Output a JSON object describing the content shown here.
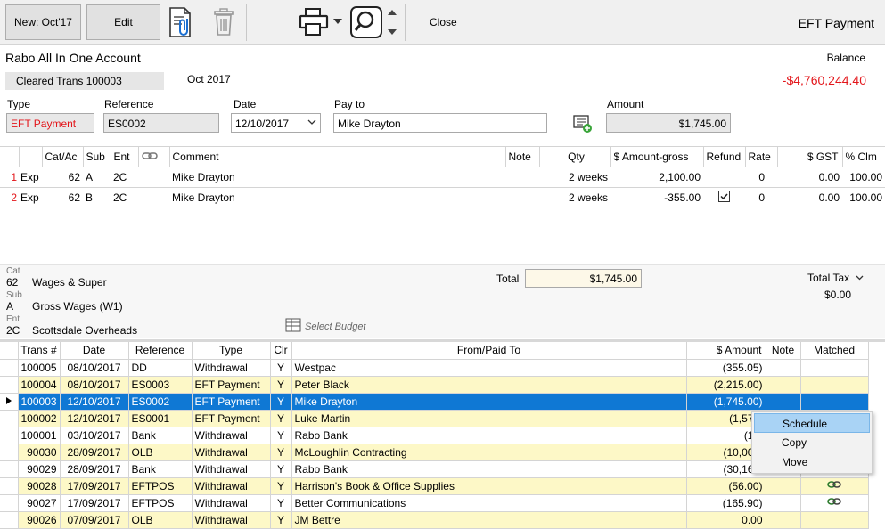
{
  "toolbar": {
    "new_label": "New: Oct'17",
    "edit_label": "Edit",
    "close_label": "Close",
    "window_title": "EFT Payment"
  },
  "account": {
    "name": "Rabo All In One Account",
    "cleared_label": "Cleared Trans  100003",
    "period": "Oct 2017",
    "balance_label": "Balance",
    "balance_value": "-$4,760,244.40"
  },
  "form": {
    "type_label": "Type",
    "type_value": "EFT Payment",
    "reference_label": "Reference",
    "reference_value": "ES0002",
    "date_label": "Date",
    "date_value": "12/10/2017",
    "payto_label": "Pay to",
    "payto_value": "Mike Drayton",
    "amount_label": "Amount",
    "amount_value": "$1,745.00"
  },
  "splits": {
    "headers": [
      "Cat/Ac",
      "Sub",
      "Ent",
      "Comment",
      "Note",
      "Qty",
      "$ Amount-gross",
      "Refund",
      "Rate",
      "$ GST",
      "% Clm"
    ],
    "rows": [
      {
        "idx": "1",
        "type": "Exp",
        "cat": "62",
        "sub": "A",
        "ent": "2C",
        "comment": "Mike Drayton",
        "note": "",
        "qty": "2 weeks",
        "amount": "2,100.00",
        "refund": "",
        "rate": "0",
        "gst": "0.00",
        "clm": "100.00"
      },
      {
        "idx": "2",
        "type": "Exp",
        "cat": "62",
        "sub": "B",
        "ent": "2C",
        "comment": "Mike Drayton",
        "note": "",
        "qty": "2 weeks",
        "amount": "-355.00",
        "refund": "checked",
        "rate": "0",
        "gst": "0.00",
        "clm": "100.00"
      }
    ]
  },
  "lookup": {
    "cat_label": "Cat",
    "cat_code": "62",
    "cat_desc": "Wages & Super",
    "sub_label": "Sub",
    "sub_code": "A",
    "sub_desc": "Gross Wages (W1)",
    "ent_label": "Ent",
    "ent_code": "2C",
    "ent_desc": "Scottsdale Overheads",
    "select_budget": "Select Budget",
    "total_label": "Total",
    "total_value": "$1,745.00",
    "total_tax_label": "Total Tax",
    "total_tax_value": "$0.00"
  },
  "transactions": {
    "headers": [
      "Trans #",
      "Date",
      "Reference",
      "Type",
      "Clr",
      "From/Paid To",
      "$ Amount",
      "Note",
      "Matched"
    ],
    "rows": [
      {
        "trans": "100005",
        "date": "08/10/2017",
        "ref": "DD",
        "type": "Withdrawal",
        "clr": "Y",
        "payee": "Westpac",
        "amount": "(355.05)",
        "note": "",
        "matched": "",
        "style": "white"
      },
      {
        "trans": "100004",
        "date": "08/10/2017",
        "ref": "ES0003",
        "type": "EFT Payment",
        "clr": "Y",
        "payee": "Peter Black",
        "amount": "(2,215.00)",
        "note": "",
        "matched": "",
        "style": "yellow"
      },
      {
        "trans": "100003",
        "date": "12/10/2017",
        "ref": "ES0002",
        "type": "EFT Payment",
        "clr": "Y",
        "payee": "Mike Drayton",
        "amount": "(1,745.00)",
        "note": "",
        "matched": "",
        "style": "sel"
      },
      {
        "trans": "100002",
        "date": "12/10/2017",
        "ref": "ES0001",
        "type": "EFT Payment",
        "clr": "Y",
        "payee": "Luke Martin",
        "amount": "(1,575.",
        "note": "",
        "matched": "",
        "style": "yellow"
      },
      {
        "trans": "100001",
        "date": "03/10/2017",
        "ref": "Bank",
        "type": "Withdrawal",
        "clr": "Y",
        "payee": "Rabo Bank",
        "amount": "(12.",
        "note": "",
        "matched": "",
        "style": "white"
      },
      {
        "trans": "90030",
        "date": "28/09/2017",
        "ref": "OLB",
        "type": "Withdrawal",
        "clr": "Y",
        "payee": "McLoughlin Contracting",
        "amount": "(10,000.",
        "note": "",
        "matched": "",
        "style": "yellow"
      },
      {
        "trans": "90029",
        "date": "28/09/2017",
        "ref": "Bank",
        "type": "Withdrawal",
        "clr": "Y",
        "payee": "Rabo Bank",
        "amount": "(30,168.",
        "note": "",
        "matched": "",
        "style": "white"
      },
      {
        "trans": "90028",
        "date": "17/09/2017",
        "ref": "EFTPOS",
        "type": "Withdrawal",
        "clr": "Y",
        "payee": "Harrison's Book & Office Supplies",
        "amount": "(56.00)",
        "note": "",
        "matched": "link",
        "style": "yellow"
      },
      {
        "trans": "90027",
        "date": "17/09/2017",
        "ref": "EFTPOS",
        "type": "Withdrawal",
        "clr": "Y",
        "payee": "Better Communications",
        "amount": "(165.90)",
        "note": "",
        "matched": "link",
        "style": "white"
      },
      {
        "trans": "90026",
        "date": "07/09/2017",
        "ref": "OLB",
        "type": "Withdrawal",
        "clr": "Y",
        "payee": "JM Bettre",
        "amount": "0.00",
        "note": "",
        "matched": "",
        "style": "yellow"
      }
    ]
  },
  "context_menu": {
    "items": [
      "Schedule",
      "Copy",
      "Move"
    ],
    "highlighted": "Schedule"
  },
  "colors": {
    "selection": "#0f78d4",
    "row_yellow": "#fdf8c7",
    "negative_red": "#e3151a",
    "menu_highlight": "#a9d3f5"
  },
  "icons": [
    "attach-document-icon",
    "trash-icon",
    "printer-icon",
    "search-icon",
    "scroll-up-icon",
    "scroll-down-icon",
    "payee-notes-icon",
    "link-icon",
    "select-budget-icon",
    "matched-link-icon",
    "row-pointer-icon",
    "checkbox-icon"
  ]
}
